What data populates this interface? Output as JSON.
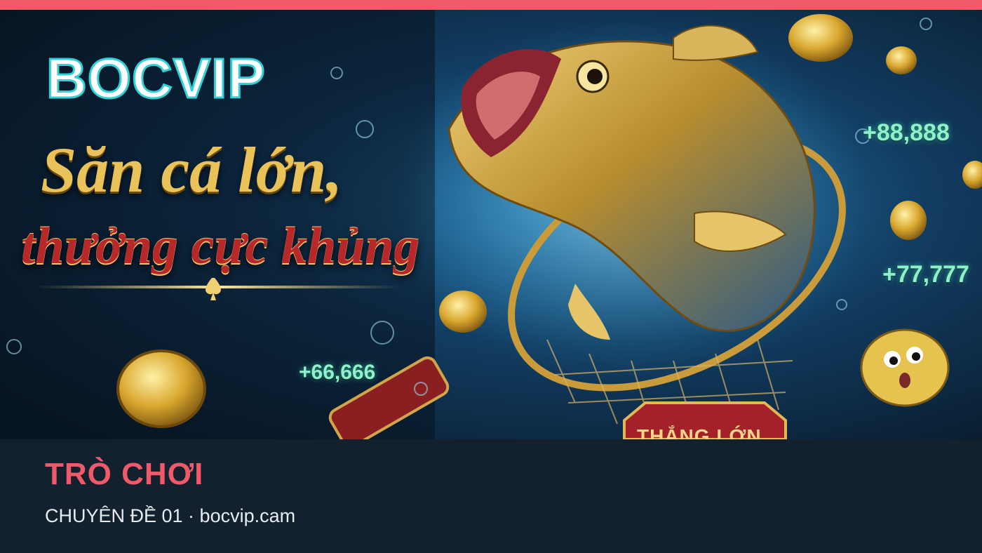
{
  "banner": {
    "brand": "BOCVIP",
    "headline_line1": "Săn cá lớn,",
    "headline_line2": "thưởng cực khủng",
    "bonus_values": [
      "+88,888",
      "+77,777",
      "+66,666"
    ],
    "win_label": "THẮNG LỚN",
    "artwork": "golden fish leaping into a net with coins and bubbles",
    "colors": {
      "brand_fill": "#ffffff",
      "brand_stroke": "#2fd0d6",
      "headline_gold": "#e9c25a",
      "headline_red": "#b7282a",
      "bonus_green": "#8ff0c9"
    }
  },
  "footer": {
    "category": "TRÒ CHƠI",
    "subtitle": "CHUYÊN ĐỀ 01 · bocvip.cam"
  },
  "colors": {
    "accent": "#ef5a6a",
    "footer_bg": "#13202d"
  }
}
